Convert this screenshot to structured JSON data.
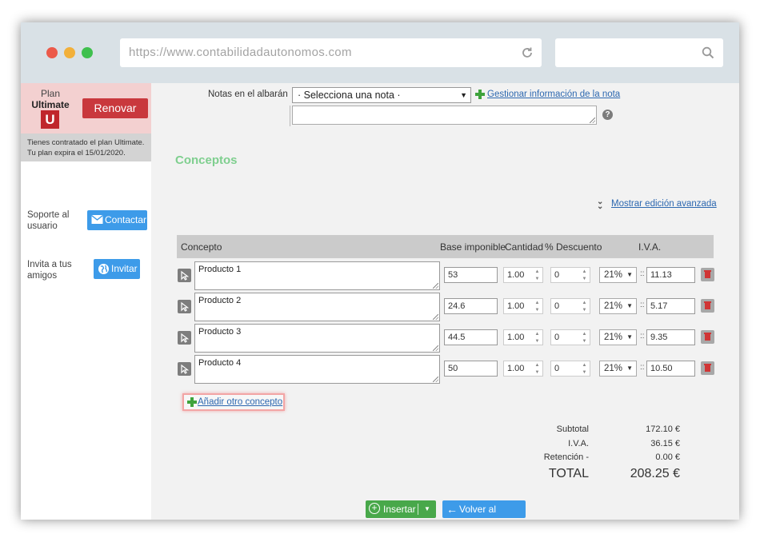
{
  "browser": {
    "url": "https://www.contabilidadautonomos.com",
    "dots": [
      "#ec5a4a",
      "#f2b03a",
      "#3fc04e"
    ]
  },
  "sidebar": {
    "plan_label": "Plan",
    "plan_name": "Ultimate",
    "plan_badge": "U",
    "renew_label": "Renovar",
    "plan_info_line1": "Tienes contratado el plan Ultimate.",
    "plan_info_line2": "Tu plan expira el 15/01/2020.",
    "support_text": "Soporte al usuario",
    "contact_label": "Contactar",
    "invite_text": "Invita a tus amigos",
    "invite_label": "Invitar"
  },
  "form": {
    "notes_label": "Notas en el albarán",
    "notes_select": "· Selecciona una nota ·",
    "manage_notes_link": "Gestionar información de la nota",
    "notes_text": "",
    "section_title": "Conceptos",
    "advanced_link": "Mostrar edición avanzada"
  },
  "table": {
    "headers": {
      "concept": "Concepto",
      "base": "Base imponible",
      "quantity": "Cantidad",
      "discount": "% Descuento",
      "iva": "I.V.A."
    },
    "rows": [
      {
        "concept": "Producto 1",
        "base": "53",
        "quantity": "1.00",
        "discount": "0",
        "iva_rate": "21%",
        "iva_amount": "11.13"
      },
      {
        "concept": "Producto 2",
        "base": "24.6",
        "quantity": "1.00",
        "discount": "0",
        "iva_rate": "21%",
        "iva_amount": "5.17"
      },
      {
        "concept": "Producto 3",
        "base": "44.5",
        "quantity": "1.00",
        "discount": "0",
        "iva_rate": "21%",
        "iva_amount": "9.35"
      },
      {
        "concept": "Producto 4",
        "base": "50",
        "quantity": "1.00",
        "discount": "0",
        "iva_rate": "21%",
        "iva_amount": "10.50"
      }
    ],
    "add_concept_link": "Añadir otro concepto"
  },
  "totals": {
    "subtotal_label": "Subtotal",
    "subtotal_value": "172.10 €",
    "iva_label": "I.V.A.",
    "iva_value": "36.15 €",
    "retention_label": "Retención -",
    "retention_value": "0.00 €",
    "total_label": "TOTAL",
    "total_value": "208.25 €"
  },
  "actions": {
    "insert_label": "Insertar",
    "back_label": "Volver al listado"
  },
  "colors": {
    "brand_red": "#c9383d",
    "link_blue": "#2d68b0",
    "accent_green": "#48a84a",
    "button_blue": "#3d9be9",
    "section_title_green": "#7fcf8f"
  }
}
